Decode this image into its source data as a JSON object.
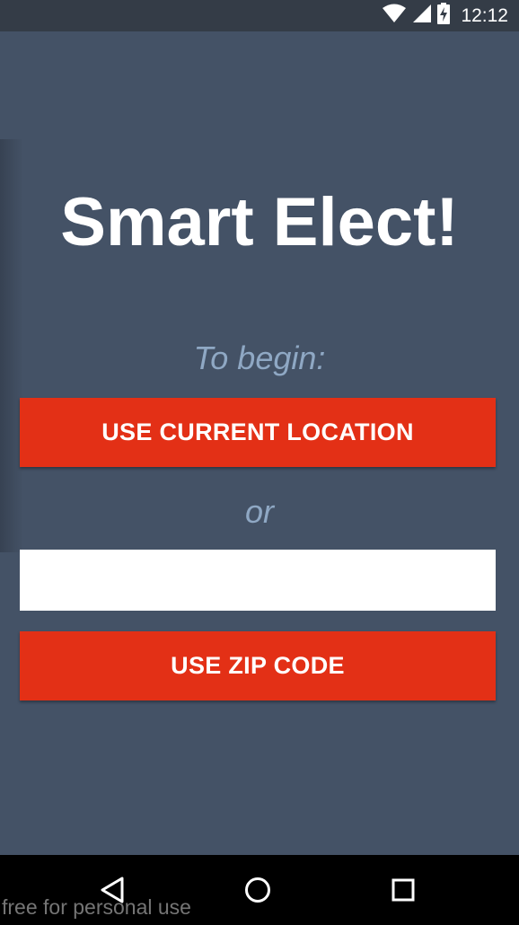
{
  "status_bar": {
    "time": "12:12",
    "icons": [
      "wifi-icon",
      "signal-icon",
      "battery-charging-icon"
    ]
  },
  "app": {
    "title": "Smart Elect!",
    "prompt": "To begin:",
    "location_button_label": "USE CURRENT LOCATION",
    "or_text": "or",
    "zip_input_value": "",
    "zip_button_label": "USE ZIP CODE"
  },
  "nav_bar": {
    "buttons": [
      "back-icon",
      "home-icon",
      "recent-apps-icon"
    ],
    "watermark": "free for personal use"
  },
  "colors": {
    "app_background": "#445266",
    "status_bar": "#343c47",
    "accent_button": "#e33016",
    "muted_text": "#8fa8c4"
  }
}
